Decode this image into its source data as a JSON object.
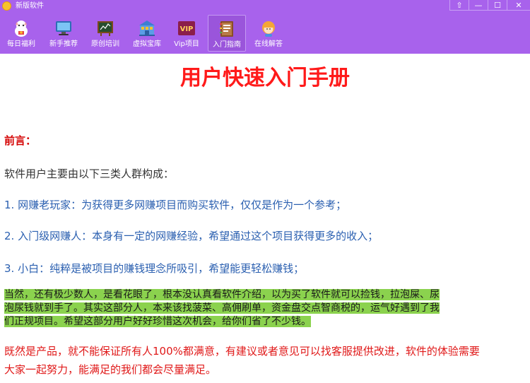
{
  "window": {
    "title": "新版软件",
    "buttons": [
      "⇧",
      "—",
      "☐",
      "✕"
    ]
  },
  "toolbar": [
    {
      "label": "每日福利",
      "icon": "lucky-cat-icon"
    },
    {
      "label": "新手推荐",
      "icon": "monitor-icon"
    },
    {
      "label": "原创培训",
      "icon": "blackboard-icon"
    },
    {
      "label": "虚拟宝库",
      "icon": "treasure-building-icon"
    },
    {
      "label": "Vip项目",
      "icon": "vip-badge-icon",
      "icon_text": "VIP"
    },
    {
      "label": "入门指南",
      "icon": "guide-book-icon",
      "active": true
    },
    {
      "label": "在线解答",
      "icon": "support-agent-icon"
    }
  ],
  "doc": {
    "title": "用户快速入门手册",
    "preface_heading": "前言：",
    "intro": "软件用户主要由以下三类人群构成：",
    "items": [
      "1. 网赚老玩家：为获得更多网赚项目而购买软件，仅仅是作为一个参考；",
      "2. 入门级网赚人：本身有一定的网赚经验，希望通过这个项目获得更多的收入；",
      "3. 小白：纯粹是被项目的赚钱理念所吸引，希望能更轻松赚钱；"
    ],
    "highlight_lines": [
      "当然，还有极少数人，是看花眼了，根本没认真看软件介绍，以为买了软件就可以捡钱，拉泡屎、尿",
      "泡尿钱就到手了。其实这部分人，本来该找菠菜、高佣刷单，资金盘交点智商税的，运气好遇到了我",
      "们正规项目。希望这部分用户好好珍惜这次机会，给你们省了不少钱。"
    ],
    "closing_lines": [
      "既然是产品，就不能保证所有人100%都满意，有建议或者意见可以找客服提供改进，软件的体验需要",
      "大家一起努力，能满足的我们都会尽量满足。"
    ]
  },
  "colors": {
    "titlebar": "#a862ec",
    "title_red": "#ff1a1a",
    "item_blue": "#2a5fb0",
    "highlight_green": "#8bd24e"
  }
}
